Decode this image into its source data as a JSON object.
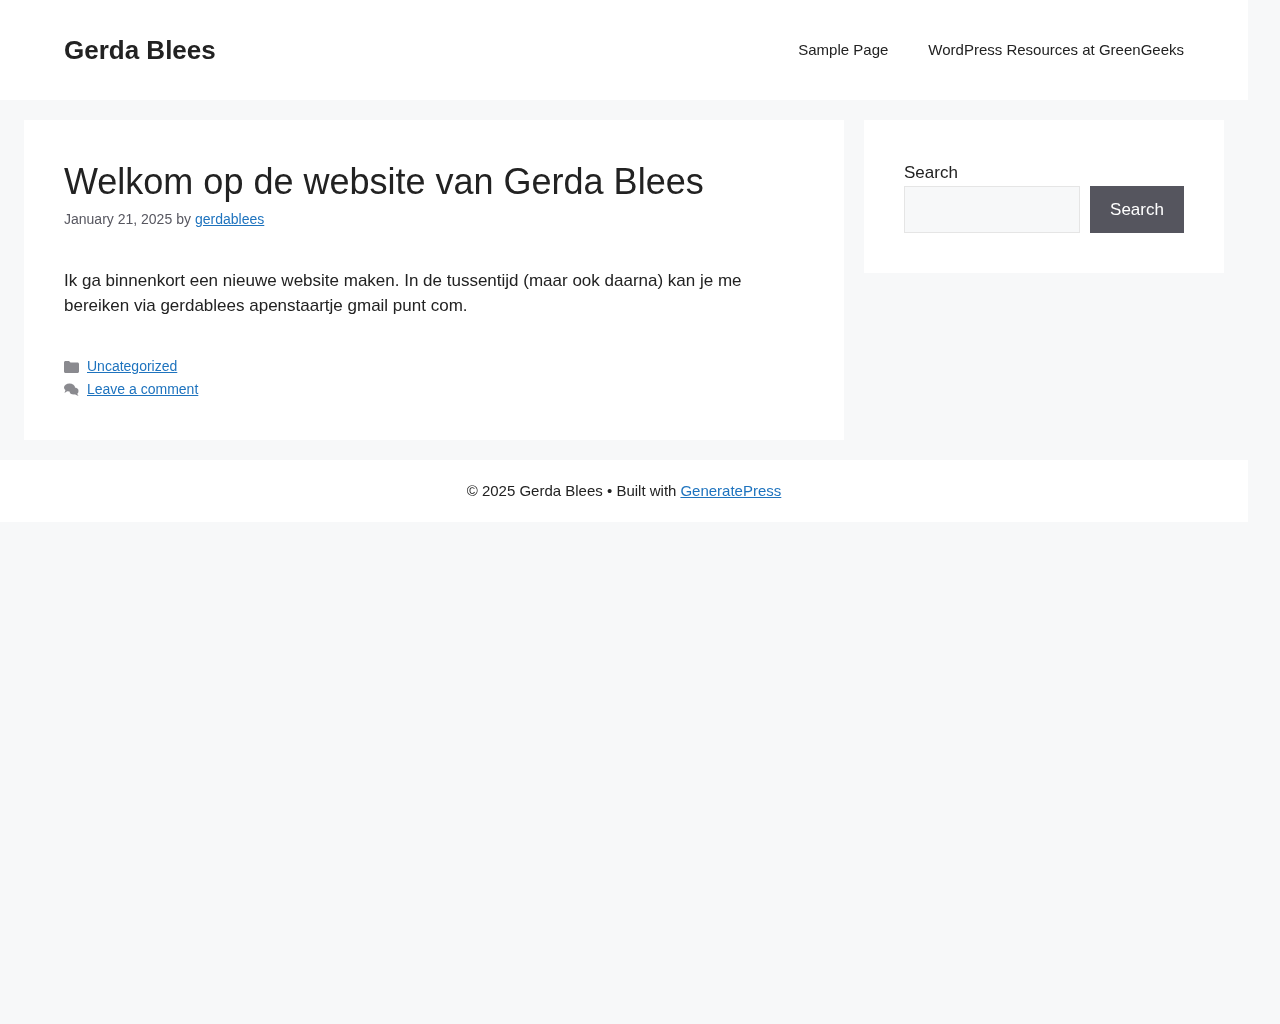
{
  "site_title": "Gerda Blees",
  "nav": [
    {
      "label": "Sample Page"
    },
    {
      "label": "WordPress Resources at GreenGeeks"
    }
  ],
  "post": {
    "title": "Welkom op de website van Gerda Blees",
    "date": "January 21, 2025",
    "by": "by",
    "author": "gerdablees",
    "body": "Ik ga binnenkort een nieuwe website maken. In de tussentijd (maar ook daarna) kan je me bereiken via gerdablees apenstaartje gmail punt com.",
    "category": "Uncategorized",
    "comment_link": "Leave a comment"
  },
  "sidebar": {
    "search_label": "Search",
    "search_button": "Search"
  },
  "footer": {
    "text": "© 2025 Gerda Blees • Built with",
    "link": "GeneratePress"
  }
}
